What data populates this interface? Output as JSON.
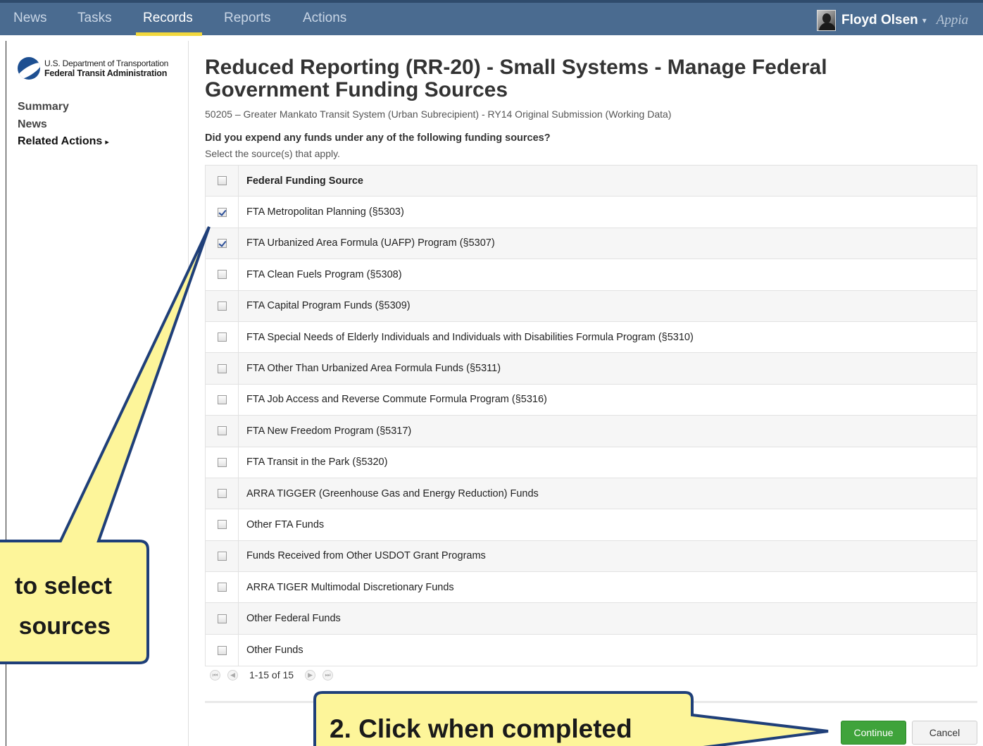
{
  "topnav": {
    "items": [
      {
        "label": "News",
        "active": false
      },
      {
        "label": "Tasks",
        "active": false
      },
      {
        "label": "Records",
        "active": true
      },
      {
        "label": "Reports",
        "active": false
      },
      {
        "label": "Actions",
        "active": false
      }
    ],
    "user_name": "Floyd Olsen",
    "user_caret": "▾",
    "app_logo": "Appia"
  },
  "sidebar": {
    "agency_line1": "U.S. Department of Transportation",
    "agency_line2": "Federal Transit Administration",
    "links": [
      "Summary",
      "News"
    ],
    "related_actions": "Related Actions",
    "related_icon": "▸"
  },
  "main": {
    "title": "Reduced Reporting (RR-20) - Small Systems - Manage Federal Government Funding Sources",
    "subtitle": "50205 – Greater Mankato Transit System (Urban Subrecipient) - RY14 Original Submission (Working Data)",
    "question": "Did you expend any funds under any of the following funding sources?",
    "instruction": "Select the source(s) that apply."
  },
  "grid": {
    "header": "Federal Funding Source",
    "rows": [
      {
        "label": "FTA Metropolitan Planning (§5303)",
        "checked": true
      },
      {
        "label": "FTA Urbanized Area Formula (UAFP) Program (§5307)",
        "checked": true
      },
      {
        "label": "FTA Clean Fuels Program (§5308)",
        "checked": false
      },
      {
        "label": "FTA Capital Program Funds (§5309)",
        "checked": false
      },
      {
        "label": "FTA Special Needs of Elderly Individuals and Individuals with Disabilities Formula Program (§5310)",
        "checked": false
      },
      {
        "label": "FTA Other Than Urbanized Area Formula Funds (§5311)",
        "checked": false
      },
      {
        "label": "FTA Job Access and Reverse Commute Formula Program (§5316)",
        "checked": false
      },
      {
        "label": "FTA New Freedom Program (§5317)",
        "checked": false
      },
      {
        "label": "FTA Transit in the Park (§5320)",
        "checked": false
      },
      {
        "label": "ARRA TIGGER (Greenhouse Gas and Energy Reduction) Funds",
        "checked": false
      },
      {
        "label": "Other FTA Funds",
        "checked": false
      },
      {
        "label": "Funds Received from Other USDOT Grant Programs",
        "checked": false
      },
      {
        "label": "ARRA TIGER Multimodal Discretionary Funds",
        "checked": false
      },
      {
        "label": "Other Federal Funds",
        "checked": false
      },
      {
        "label": "Other Funds",
        "checked": false
      }
    ]
  },
  "pager": {
    "range": "1-15 of 15",
    "first_icon": "⏮",
    "prev_icon": "◀",
    "next_icon": "▶",
    "last_icon": "⏭"
  },
  "buttons": {
    "continue": "Continue",
    "cancel": "Cancel"
  },
  "callouts": {
    "select_line1": "to select",
    "select_line2": "sources",
    "completed": "2. Click when completed"
  },
  "colors": {
    "topbar": "#4a6b90",
    "nav_underline": "#f2d83c",
    "continue_button": "#3fa33b",
    "callout_fill": "#fdf59a",
    "callout_border": "#1f3f79"
  }
}
